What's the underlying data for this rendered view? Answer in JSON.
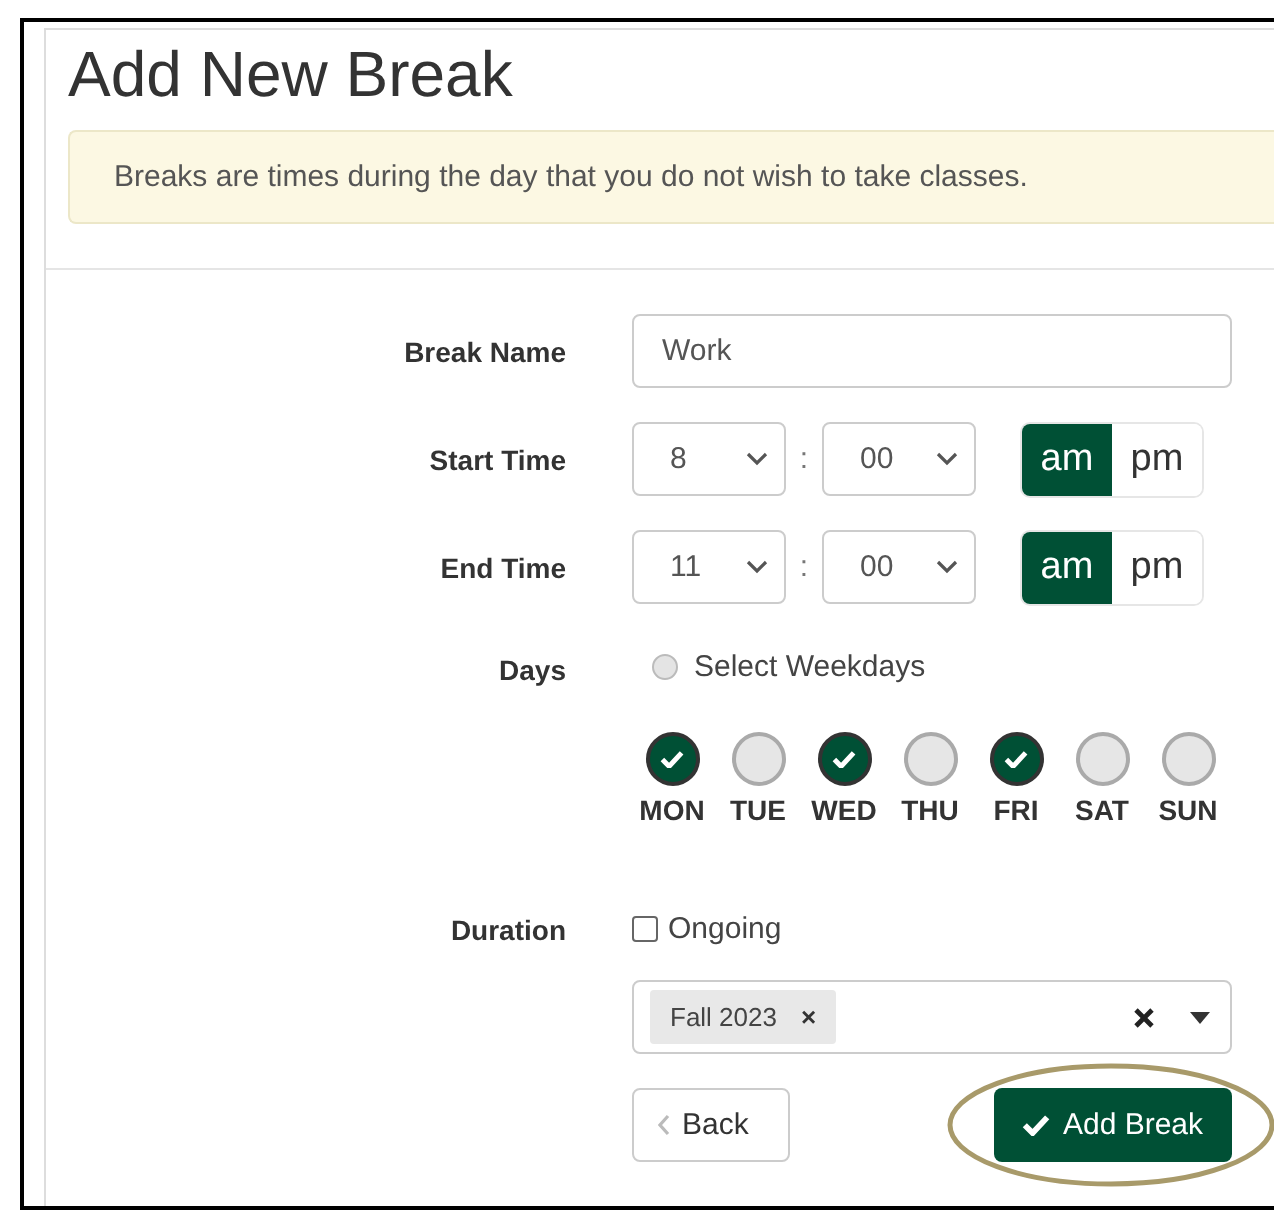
{
  "title": "Add New Break",
  "notice": "Breaks are times during the day that you do not wish to take classes.",
  "break_name": {
    "label": "Break Name",
    "value": "Work"
  },
  "times": [
    {
      "label": "Start Time",
      "hour": "8",
      "separator": ":",
      "minute": "00",
      "meridiem": [
        {
          "label": "am",
          "selected": true
        },
        {
          "label": "pm",
          "selected": false
        }
      ]
    },
    {
      "label": "End Time",
      "hour": "11",
      "separator": ":",
      "minute": "00",
      "meridiem": [
        {
          "label": "am",
          "selected": true
        },
        {
          "label": "pm",
          "selected": false
        }
      ]
    }
  ],
  "days": {
    "label": "Days",
    "select_weekdays": {
      "label": "Select Weekdays",
      "selected": false
    },
    "items": [
      {
        "label": "MON",
        "checked": true
      },
      {
        "label": "TUE",
        "checked": false
      },
      {
        "label": "WED",
        "checked": true
      },
      {
        "label": "THU",
        "checked": false
      },
      {
        "label": "FRI",
        "checked": true
      },
      {
        "label": "SAT",
        "checked": false
      },
      {
        "label": "SUN",
        "checked": false
      }
    ]
  },
  "duration": {
    "label": "Duration",
    "ongoing": {
      "label": "Ongoing",
      "checked": false
    },
    "terms": [
      {
        "label": "Fall 2023",
        "remove": "×"
      }
    ]
  },
  "buttons": {
    "back": "Back",
    "submit": "Add Break"
  },
  "annotation": {
    "kind": "ellipse"
  }
}
